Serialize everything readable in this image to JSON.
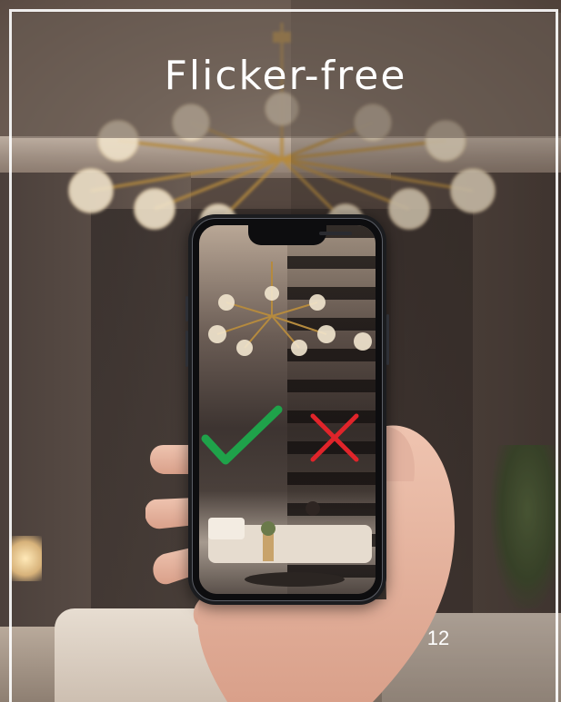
{
  "title": "Flicker-free",
  "page_number": "12",
  "icons": {
    "check": "check-mark-icon",
    "cross": "cross-mark-icon"
  },
  "colors": {
    "check": "#1fa24a",
    "cross": "#e0242a",
    "title_text": "#ffffff",
    "frame": "#ffffff"
  }
}
